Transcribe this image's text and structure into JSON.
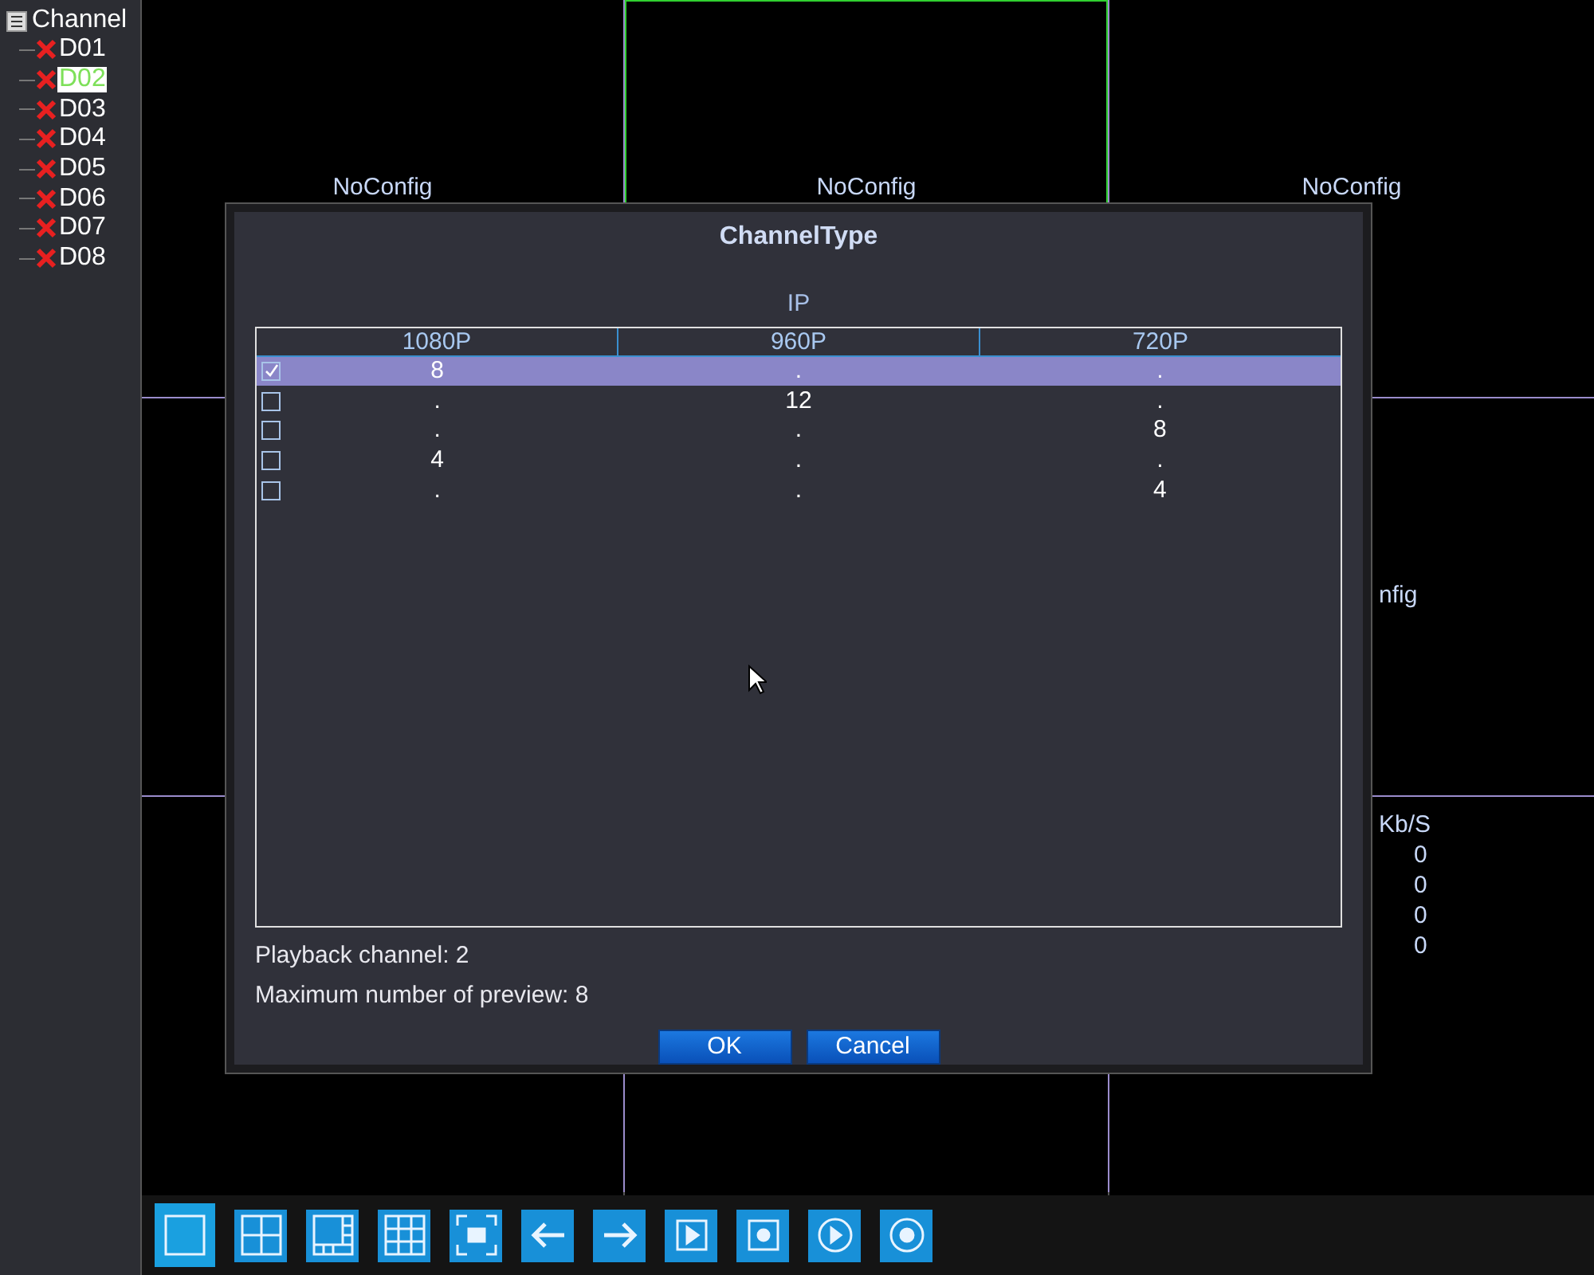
{
  "sidebar": {
    "title": "Channel",
    "children": [
      {
        "label": "D01",
        "selected": false
      },
      {
        "label": "D02",
        "selected": true
      },
      {
        "label": "D03",
        "selected": false
      },
      {
        "label": "D04",
        "selected": false
      },
      {
        "label": "D05",
        "selected": false
      },
      {
        "label": "D06",
        "selected": false
      },
      {
        "label": "D07",
        "selected": false
      },
      {
        "label": "D08",
        "selected": false
      }
    ]
  },
  "cells": [
    {
      "kind": "label",
      "text": "NoConfig",
      "selected": false
    },
    {
      "kind": "label",
      "text": "NoConfig",
      "selected": true
    },
    {
      "kind": "label",
      "text": "NoConfig",
      "selected": false
    },
    {
      "kind": "empty",
      "selected": false
    },
    {
      "kind": "empty"
    },
    {
      "kind": "partial",
      "text": "nfig",
      "selected": false
    },
    {
      "kind": "empty",
      "selected": false
    },
    {
      "kind": "empty",
      "selected": false
    },
    {
      "kind": "stats",
      "text": "Kb/S",
      "values": [
        "0",
        "0",
        "0",
        "0"
      ],
      "selected": false
    }
  ],
  "dialog": {
    "title": "ChannelType",
    "group": "IP",
    "columns": [
      "1080P",
      "960P",
      "720P"
    ],
    "rows": [
      {
        "checked": true,
        "selected": true,
        "values": [
          "8",
          ".",
          "."
        ]
      },
      {
        "checked": false,
        "selected": false,
        "values": [
          ".",
          "12",
          "."
        ]
      },
      {
        "checked": false,
        "selected": false,
        "values": [
          ".",
          ".",
          "8"
        ]
      },
      {
        "checked": false,
        "selected": false,
        "values": [
          "4",
          ".",
          "."
        ]
      },
      {
        "checked": false,
        "selected": false,
        "values": [
          ".",
          ".",
          "4"
        ]
      }
    ],
    "info": [
      "Playback channel: 2",
      "Maximum number of preview: 8"
    ],
    "buttons": [
      "OK",
      "Cancel"
    ]
  },
  "toolbar": [
    {
      "kind": "single",
      "selected": true
    },
    {
      "kind": "quad",
      "selected": false
    },
    {
      "kind": "six",
      "selected": false
    },
    {
      "kind": "nine",
      "selected": false
    },
    {
      "kind": "full",
      "selected": false
    },
    {
      "kind": "left",
      "selected": false
    },
    {
      "kind": "right",
      "selected": false
    },
    {
      "kind": "play-square",
      "selected": false
    },
    {
      "kind": "record-square",
      "selected": false
    },
    {
      "kind": "play-circle",
      "selected": false
    },
    {
      "kind": "record-circle",
      "selected": false
    }
  ]
}
